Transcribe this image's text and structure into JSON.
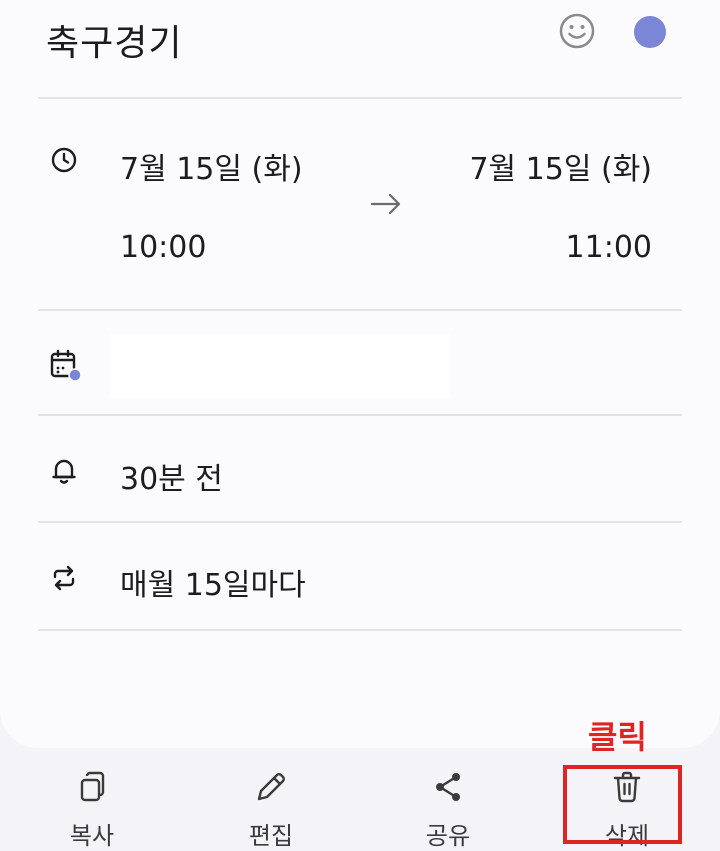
{
  "event": {
    "title": "축구경기",
    "start_date": "7월 15일 (화)",
    "start_time": "10:00",
    "end_date": "7월 15일 (화)",
    "end_time": "11:00",
    "reminder": "30분 전",
    "repeat": "매월 15일마다"
  },
  "colors": {
    "event_color": "#7b86d6",
    "annotation": "#e02424"
  },
  "bottom_bar": {
    "copy_label": "복사",
    "edit_label": "편집",
    "share_label": "공유",
    "delete_label": "삭제"
  },
  "annotation": {
    "text": "클릭"
  }
}
